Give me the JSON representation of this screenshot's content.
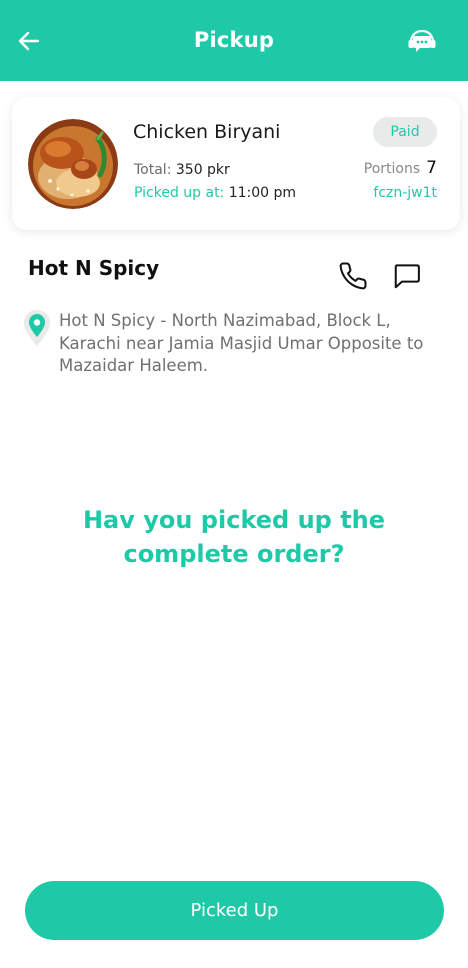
{
  "header": {
    "title": "Pickup",
    "back_icon": "arrow-left-icon",
    "support_icon": "support-chat-icon"
  },
  "order": {
    "food_name": "Chicken Biryani",
    "total_label": "Total:",
    "total_value": "350 pkr",
    "picked_label": "Picked up at:",
    "picked_value": "11:00 pm",
    "status": "Paid",
    "portions_label": "Portions",
    "portions_value": "7",
    "code": "fczn-jw1t"
  },
  "restaurant": {
    "name": "Hot N Spicy",
    "address": "Hot N Spicy - North Nazimabad, Block L, Karachi near Jamia Masjid Umar Opposite to Mazaidar Haleem."
  },
  "prompt": {
    "question": "Hav you picked up the complete order?"
  },
  "actions": {
    "picked_up_label": "Picked Up"
  },
  "colors": {
    "accent": "#1fc9a8"
  }
}
